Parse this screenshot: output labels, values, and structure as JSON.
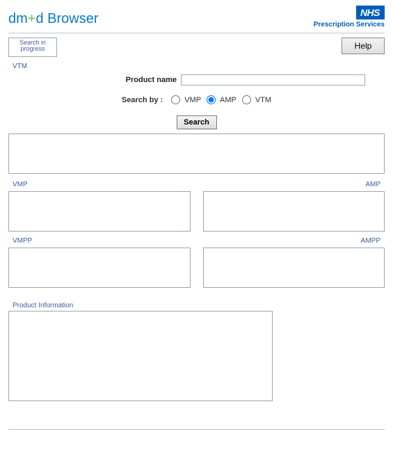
{
  "header": {
    "brand_dm": "dm",
    "brand_plus": "+",
    "brand_d": "d",
    "brand_browser": " Browser",
    "nhs": "NHS",
    "prescription_services": "Prescription Services"
  },
  "toolbar": {
    "progress_text": "Search in progress",
    "help_label": "Help"
  },
  "search": {
    "vtm_label": "VTM",
    "product_name_label": "Product name",
    "product_name_value": "",
    "search_by_label": "Search by :",
    "options": {
      "vmp": "VMP",
      "amp": "AMP",
      "vtm": "VTM"
    },
    "selected": "AMP",
    "search_button": "Search"
  },
  "panels": {
    "vmp": "VMP",
    "amp": "AMP",
    "vmpp": "VMPP",
    "ampp": "AMPP",
    "product_info": "Product Information"
  }
}
